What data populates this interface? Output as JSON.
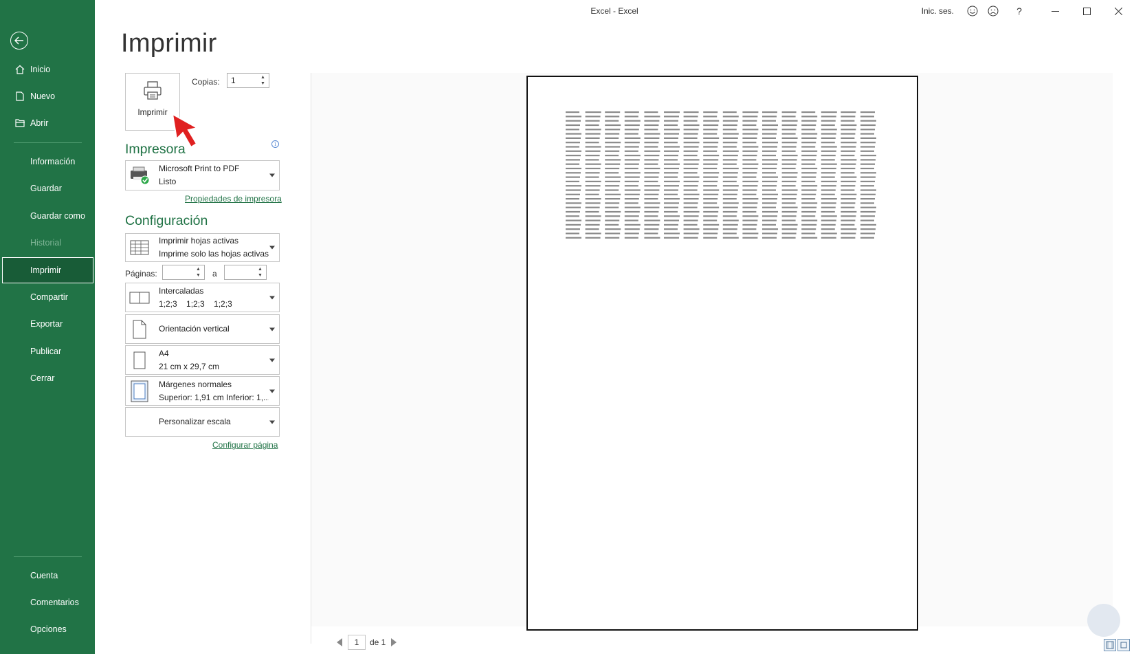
{
  "window": {
    "title": "Excel - Excel",
    "sign_in": "Inic. ses.",
    "help": "?"
  },
  "sidebar": {
    "items": [
      {
        "label": "Inicio",
        "icon": "home-icon"
      },
      {
        "label": "Nuevo",
        "icon": "new-document-icon"
      },
      {
        "label": "Abrir",
        "icon": "open-folder-icon"
      },
      {
        "label": "Información"
      },
      {
        "label": "Guardar"
      },
      {
        "label": "Guardar como"
      },
      {
        "label": "Historial",
        "disabled": true
      },
      {
        "label": "Imprimir",
        "active": true
      },
      {
        "label": "Compartir"
      },
      {
        "label": "Exportar"
      },
      {
        "label": "Publicar"
      },
      {
        "label": "Cerrar"
      },
      {
        "label": "Cuenta"
      },
      {
        "label": "Comentarios"
      },
      {
        "label": "Opciones"
      }
    ]
  },
  "print": {
    "title": "Imprimir",
    "button_label": "Imprimir",
    "copies_label": "Copias:",
    "copies_value": "1",
    "printer_heading": "Impresora",
    "printer_name": "Microsoft Print to PDF",
    "printer_status": "Listo",
    "printer_props_link": "Propiedades de impresora",
    "config_heading": "Configuración",
    "what_line1": "Imprimir hojas activas",
    "what_line2": "Imprime solo las hojas activas",
    "pages_label": "Páginas:",
    "pages_from": "",
    "pages_to_label": "a",
    "pages_to": "",
    "collate_line1": "Intercaladas",
    "collate_line2": "1;2;3    1;2;3    1;2;3",
    "orientation": "Orientación vertical",
    "paper_line1": "A4",
    "paper_line2": "21 cm x 29,7 cm",
    "margins_line1": "Márgenes normales",
    "margins_line2": "Superior: 1,91 cm Inferior: 1,...",
    "scaling": "Personalizar escala",
    "page_setup_link": "Configurar página"
  },
  "preview": {
    "current_page": "1",
    "of_label": "de 1"
  },
  "colors": {
    "brand_green": "#217346",
    "active_green": "#185c37",
    "arrow_red": "#e02020"
  }
}
